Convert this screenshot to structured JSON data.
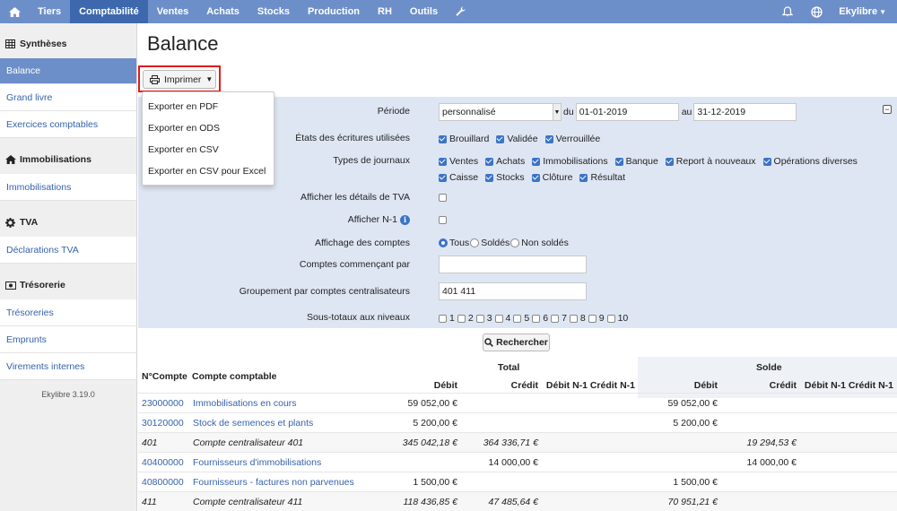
{
  "nav": {
    "items": [
      "Tiers",
      "Comptabilité",
      "Ventes",
      "Achats",
      "Stocks",
      "Production",
      "RH",
      "Outils"
    ],
    "active": "Comptabilité",
    "user": "Ekylibre",
    "colors": {
      "bar": "#6d8fc9",
      "active": "#3d68ad"
    }
  },
  "sidebar": {
    "sections": [
      {
        "title": "Synthèses",
        "icon": "table-icon",
        "items": [
          "Balance",
          "Grand livre",
          "Exercices comptables"
        ]
      },
      {
        "title": "Immobilisations",
        "icon": "home-icon",
        "items": [
          "Immobilisations"
        ]
      },
      {
        "title": "TVA",
        "icon": "gear-icon",
        "items": [
          "Déclarations TVA"
        ]
      },
      {
        "title": "Trésorerie",
        "icon": "money-icon",
        "items": [
          "Trésoreries",
          "Emprunts",
          "Virements internes"
        ]
      }
    ],
    "active_item": "Balance",
    "version": "Ekylibre 3.19.0"
  },
  "page": {
    "title": "Balance"
  },
  "print": {
    "label": "Imprimer",
    "menu": [
      "Exporter en PDF",
      "Exporter en ODS",
      "Exporter en CSV",
      "Exporter en CSV pour Excel"
    ],
    "highlight_color": "#e01b1b"
  },
  "filters": {
    "periode": {
      "label": "Période",
      "select": "personnalisé",
      "du_label": "du",
      "from": "01-01-2019",
      "au_label": "au",
      "to": "31-12-2019"
    },
    "etats": {
      "label": "États des écritures utilisées",
      "options": [
        {
          "label": "Brouillard",
          "checked": true
        },
        {
          "label": "Validée",
          "checked": true
        },
        {
          "label": "Verrouillée",
          "checked": true
        }
      ]
    },
    "types": {
      "label": "Types de journaux",
      "row1": [
        {
          "label": "Ventes",
          "checked": true
        },
        {
          "label": "Achats",
          "checked": true
        },
        {
          "label": "Immobilisations",
          "checked": true
        },
        {
          "label": "Banque",
          "checked": true
        },
        {
          "label": "Report à nouveaux",
          "checked": true
        },
        {
          "label": "Opérations diverses",
          "checked": true
        }
      ],
      "row2": [
        {
          "label": "Caisse",
          "checked": true
        },
        {
          "label": "Stocks",
          "checked": true
        },
        {
          "label": "Clôture",
          "checked": true
        },
        {
          "label": "Résultat",
          "checked": true
        }
      ]
    },
    "tva": {
      "label": "Afficher les détails de TVA",
      "checked": false
    },
    "n1": {
      "label": "Afficher N-1",
      "info": "i",
      "checked": false
    },
    "affichage": {
      "label": "Affichage des comptes",
      "options": [
        {
          "label": "Tous",
          "selected": true
        },
        {
          "label": "Soldés",
          "selected": false
        },
        {
          "label": "Non soldés",
          "selected": false
        }
      ]
    },
    "commencant": {
      "label": "Comptes commençant par",
      "value": ""
    },
    "groupement": {
      "label": "Groupement par comptes centralisateurs",
      "value": "401 411"
    },
    "sous_totaux": {
      "label": "Sous-totaux aux niveaux",
      "levels": [
        "1",
        "2",
        "3",
        "4",
        "5",
        "6",
        "7",
        "8",
        "9",
        "10"
      ]
    },
    "collapse": "−",
    "search_label": "Rechercher",
    "panel_color": "#dfe6f3"
  },
  "table": {
    "group_total": "Total",
    "group_solde": "Solde",
    "col_num": "N°Compte",
    "col_account": "Compte comptable",
    "sub": [
      "Débit",
      "Crédit",
      "Débit N-1",
      "Crédit N-1"
    ],
    "rows": [
      {
        "num": "23000000",
        "name": "Immobilisations en cours",
        "debit": "59 052,00 €",
        "credit": "",
        "sdebit": "59 052,00 €",
        "scredit": "",
        "link": true
      },
      {
        "num": "30120000",
        "name": "Stock de semences et plants",
        "debit": "5 200,00 €",
        "credit": "",
        "sdebit": "5 200,00 €",
        "scredit": "",
        "link": true
      },
      {
        "num": "401",
        "name": "Compte centralisateur 401",
        "debit": "345 042,18 €",
        "credit": "364 336,71 €",
        "sdebit": "",
        "scredit": "19 294,53 €",
        "link": false
      },
      {
        "num": "40400000",
        "name": "Fournisseurs d'immobilisations",
        "debit": "",
        "credit": "14 000,00 €",
        "sdebit": "",
        "scredit": "14 000,00 €",
        "link": true
      },
      {
        "num": "40800000",
        "name": "Fournisseurs - factures non parvenues",
        "debit": "1 500,00 €",
        "credit": "",
        "sdebit": "1 500,00 €",
        "scredit": "",
        "link": true
      },
      {
        "num": "411",
        "name": "Compte centralisateur 411",
        "debit": "118 436,85 €",
        "credit": "47 485,64 €",
        "sdebit": "70 951,21 €",
        "scredit": "",
        "link": false
      }
    ]
  }
}
